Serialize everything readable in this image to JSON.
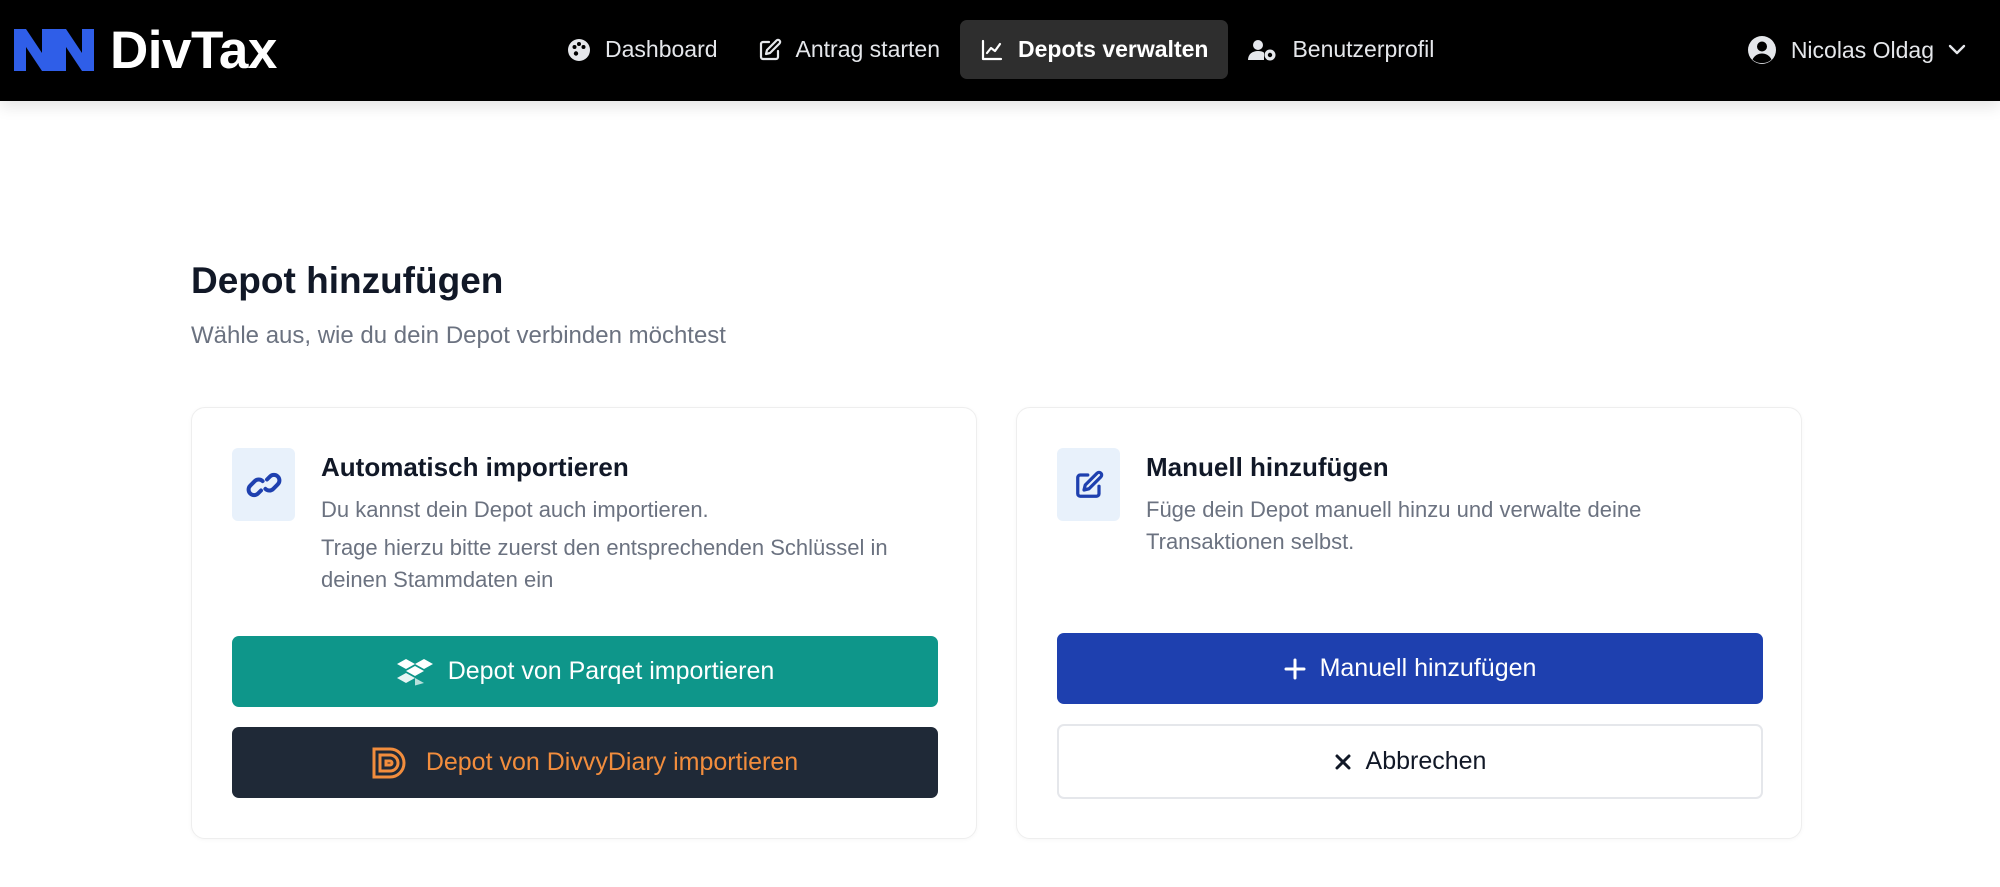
{
  "brand": {
    "name": "DivTax"
  },
  "nav": {
    "items": [
      {
        "label": "Dashboard",
        "icon": "palette-icon"
      },
      {
        "label": "Antrag starten",
        "icon": "edit-icon"
      },
      {
        "label": "Depots verwalten",
        "icon": "chart-line-icon",
        "active": true
      },
      {
        "label": "Benutzerprofil",
        "icon": "user-gear-icon"
      }
    ]
  },
  "user": {
    "name": "Nicolas Oldag",
    "icon": "user-circle-icon"
  },
  "page": {
    "title": "Depot hinzufügen",
    "subtitle": "Wähle aus, wie du dein Depot verbinden möchtest"
  },
  "auto_card": {
    "icon": "link-icon",
    "title": "Automatisch importieren",
    "desc_1": "Du kannst dein Depot auch importieren.",
    "desc_2": "Trage hierzu bitte zuerst den entsprechenden Schlüssel in deinen Stammdaten ein",
    "parqet_button": "Depot von Parqet importieren",
    "divvy_button": "Depot von DivvyDiary importieren"
  },
  "manual_card": {
    "icon": "edit-icon",
    "title": "Manuell hinzufügen",
    "desc": "Füge dein Depot manuell hinzu und verwalte deine Transaktionen selbst.",
    "add_button": "Manuell hinzufügen",
    "cancel_button": "Abbrechen"
  },
  "colors": {
    "topbar": "#000000",
    "brand_logo": "#2f5ee8",
    "parqet": "#0e968a",
    "divvy_bg": "#1f2937",
    "divvy_text": "#f28d3d",
    "primary": "#1e40af",
    "icon_bg": "#e8f1fb"
  }
}
